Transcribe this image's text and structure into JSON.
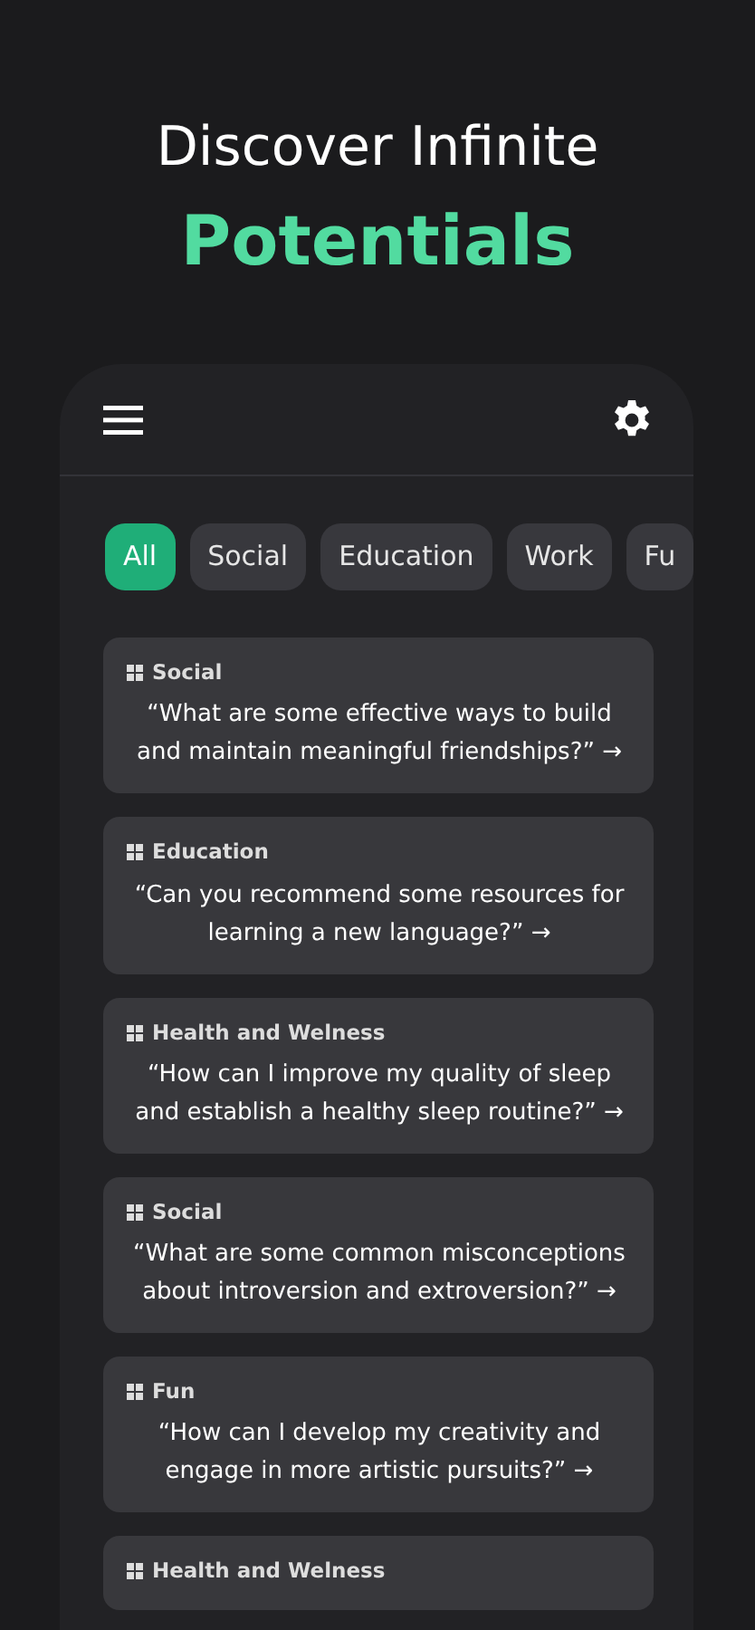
{
  "headline": {
    "line_1": "Discover Infinite",
    "line_2": "Potentials"
  },
  "categories": [
    {
      "label": "All",
      "selected": true
    },
    {
      "label": "Social",
      "selected": false
    },
    {
      "label": "Education",
      "selected": false
    },
    {
      "label": "Work",
      "selected": false
    },
    {
      "label": "Fu",
      "selected": false
    }
  ],
  "prompts": [
    {
      "category": "Social",
      "question": "“What are some effective ways to build and maintain meaningful friendships?” →"
    },
    {
      "category": "Education",
      "question": "“Can you recommend some resources for learning a new language?” →"
    },
    {
      "category": "Health and Welness",
      "question": "“How can I improve my quality of sleep and establish a healthy sleep routine?” →"
    },
    {
      "category": "Social",
      "question": "“What are some common misconceptions about introversion and extroversion?” →"
    },
    {
      "category": "Fun",
      "question": "“How can I develop my creativity and engage in more artistic pursuits?” →"
    },
    {
      "category": "Health and Welness"
    }
  ]
}
